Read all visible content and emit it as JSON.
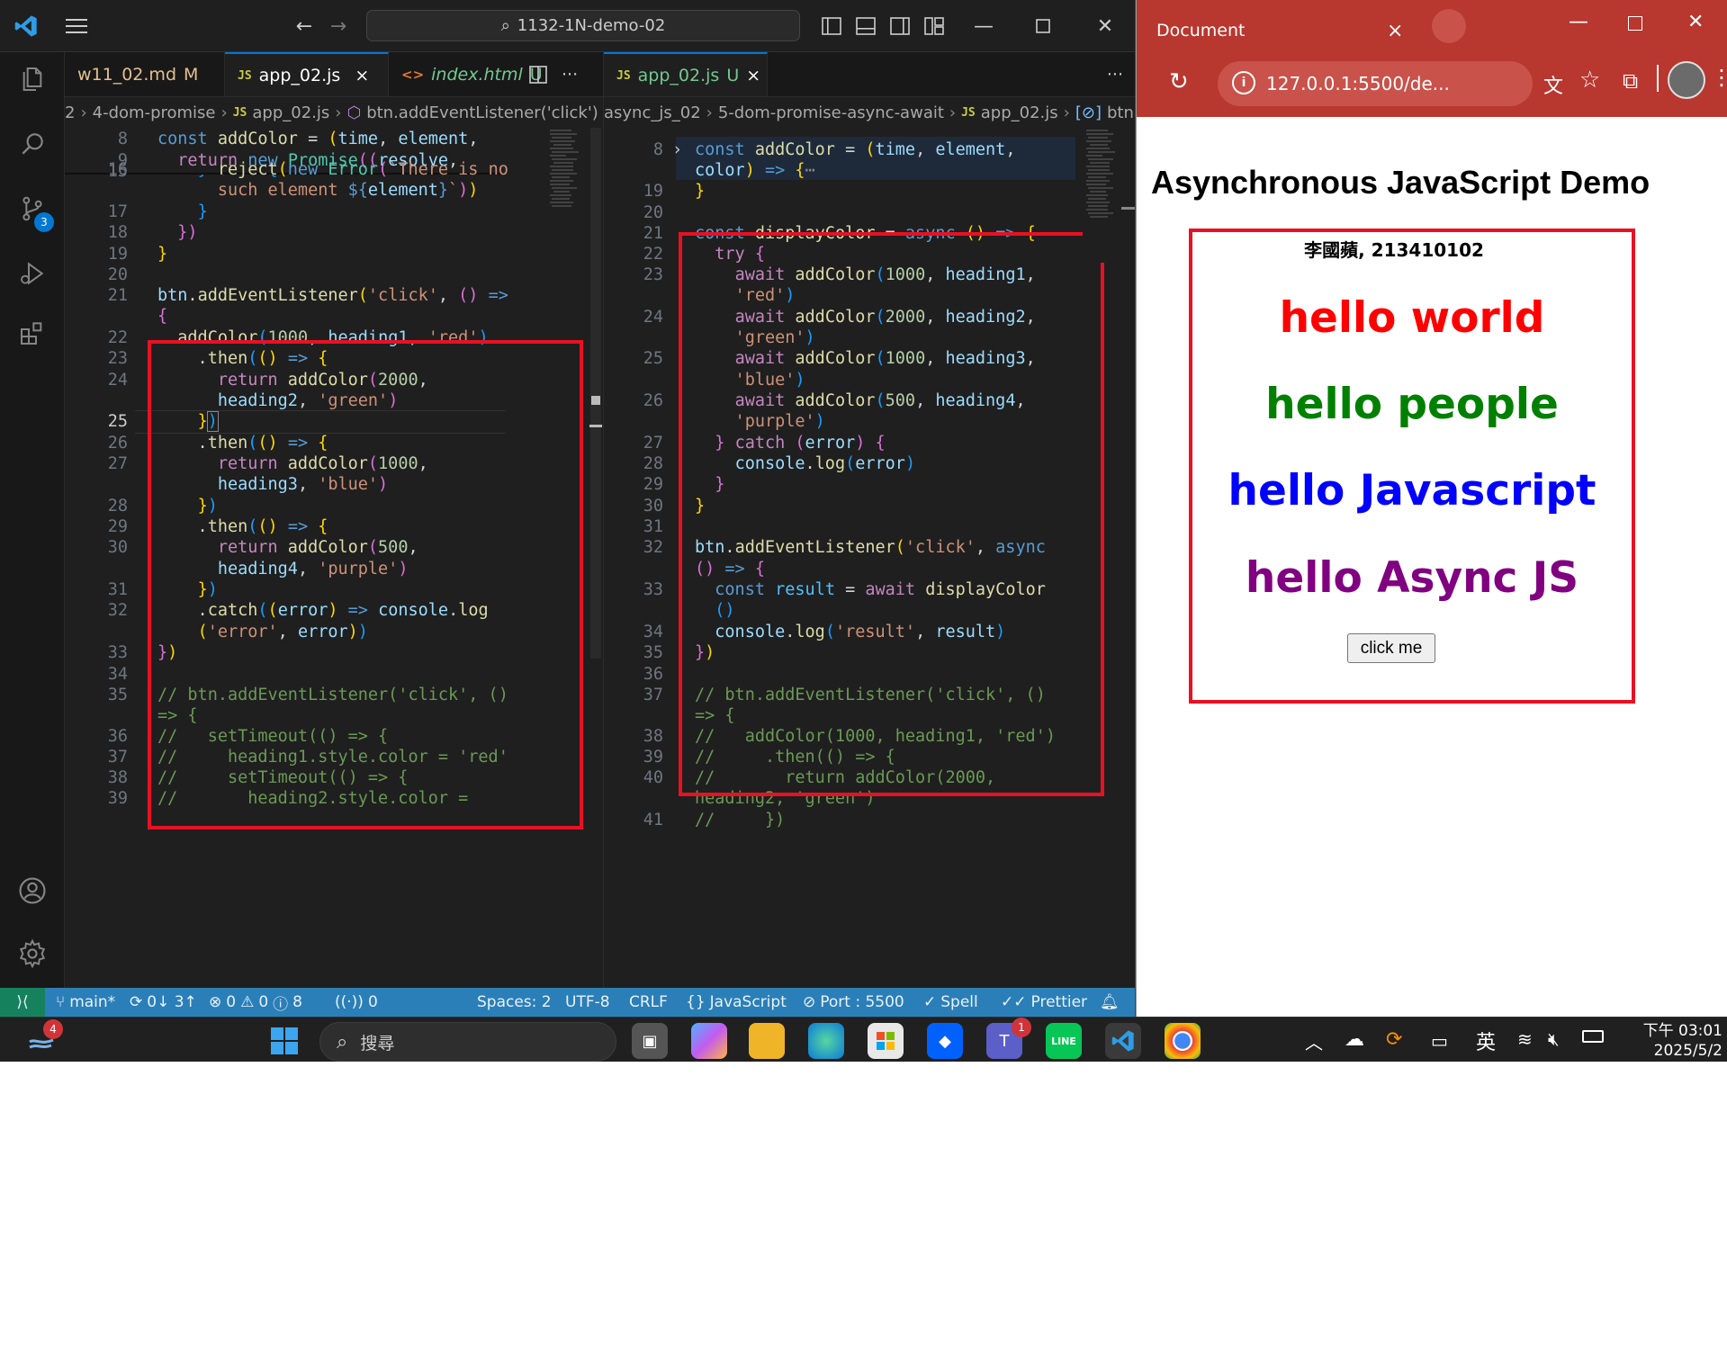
{
  "vscode": {
    "title": "1132-1N-demo-02",
    "scm_badge": "3",
    "left_group": {
      "tabs": [
        {
          "label": "w11_02.md",
          "status": "M"
        },
        {
          "label": "app_02.js",
          "icon": "JS",
          "close": "×"
        },
        {
          "label": "index.html",
          "status": "U",
          "icon": "<>"
        }
      ],
      "breadcrumb": [
        "2",
        "4-dom-promise",
        "app_02.js",
        "btn.addEventListener('click')"
      ]
    },
    "right_group": {
      "tabs": [
        {
          "label": "app_02.js",
          "status": "U",
          "icon": "JS",
          "close": "×"
        }
      ],
      "breadcrumb": [
        "async_js_02",
        "5-dom-promise-async-await",
        "app_02.js",
        "btn"
      ]
    }
  },
  "status": {
    "branch": "main*",
    "sync": "0↓ 3↑",
    "errors": "0",
    "warnings": "0",
    "info": "8",
    "ports": "0",
    "spaces": "Spaces: 2",
    "encoding": "UTF-8",
    "eol": "CRLF",
    "language": "JavaScript",
    "port": "Port : 5500",
    "spell": "Spell",
    "prettier": "Prettier"
  },
  "browser": {
    "tab_title": "Document",
    "tab_close": "×",
    "url": "127.0.0.1:5500/de...",
    "page": {
      "heading": "Asynchronous JavaScript Demo",
      "author": "李國蘋, 213410102",
      "headings": [
        {
          "text": "hello world",
          "color": "#ff0000"
        },
        {
          "text": "hello people",
          "color": "#008000"
        },
        {
          "text": "hello Javascript",
          "color": "#0000ff"
        },
        {
          "text": "hello Async JS",
          "color": "#800080"
        }
      ],
      "button": "click me"
    }
  },
  "taskbar": {
    "search_placeholder": "搜尋",
    "weather_badge": "4",
    "teams_badge": "1",
    "ime": "英",
    "time": "下午 03:01",
    "date": "2025/5/2"
  },
  "theme": {
    "accent": "#0078d4",
    "statusbar": "#2b7fb8",
    "browser_frame": "#b8372f",
    "highlight_box": "#e81123"
  }
}
